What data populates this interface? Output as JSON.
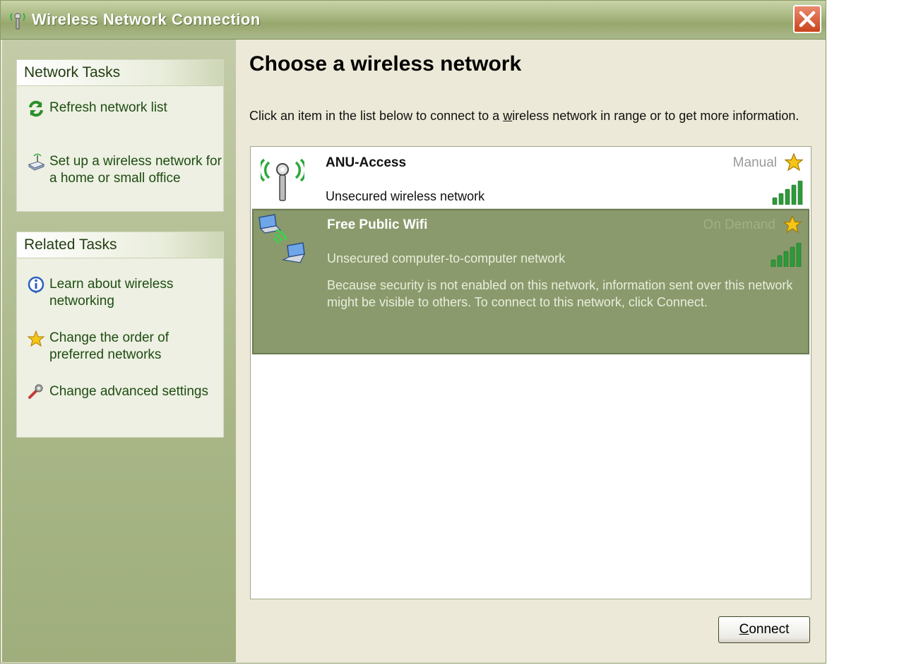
{
  "window": {
    "title": "Wireless Network Connection"
  },
  "sidebar": {
    "network_tasks": {
      "header": "Network Tasks",
      "items": [
        {
          "label": "Refresh network list",
          "icon": "refresh-icon"
        },
        {
          "label": "Set up a wireless network for a home or small office",
          "icon": "setup-network-icon"
        }
      ]
    },
    "related_tasks": {
      "header": "Related Tasks",
      "items": [
        {
          "label": "Learn about wireless networking",
          "icon": "info-icon"
        },
        {
          "label": "Change the order of preferred networks",
          "icon": "star-icon"
        },
        {
          "label": "Change advanced settings",
          "icon": "settings-tool-icon"
        }
      ]
    }
  },
  "main": {
    "heading": "Choose a wireless network",
    "instructions_pre": "Click an item in the list below to connect to a ",
    "instructions_u": "w",
    "instructions_post": "ireless network in range or to get more information.",
    "networks": [
      {
        "name": "ANU-Access",
        "mode": "Manual",
        "description": "Unsecured wireless network",
        "icon": "antenna-icon",
        "signal_bars": 5,
        "selected": false
      },
      {
        "name": "Free Public Wifi",
        "mode": "On Demand",
        "description": "Unsecured computer-to-computer network",
        "note": "Because security is not enabled on this network, information sent over this network might be visible to others. To connect to this network, click Connect.",
        "icon": "adhoc-computers-icon",
        "signal_bars": 5,
        "selected": true
      }
    ],
    "connect_pre": "",
    "connect_u": "C",
    "connect_post": "onnect"
  },
  "colors": {
    "sidebar_bg": "#a9b788",
    "selected_item_bg": "#8a9a6c",
    "task_link": "#1f4d13",
    "signal_green": "#2e9a3a"
  }
}
